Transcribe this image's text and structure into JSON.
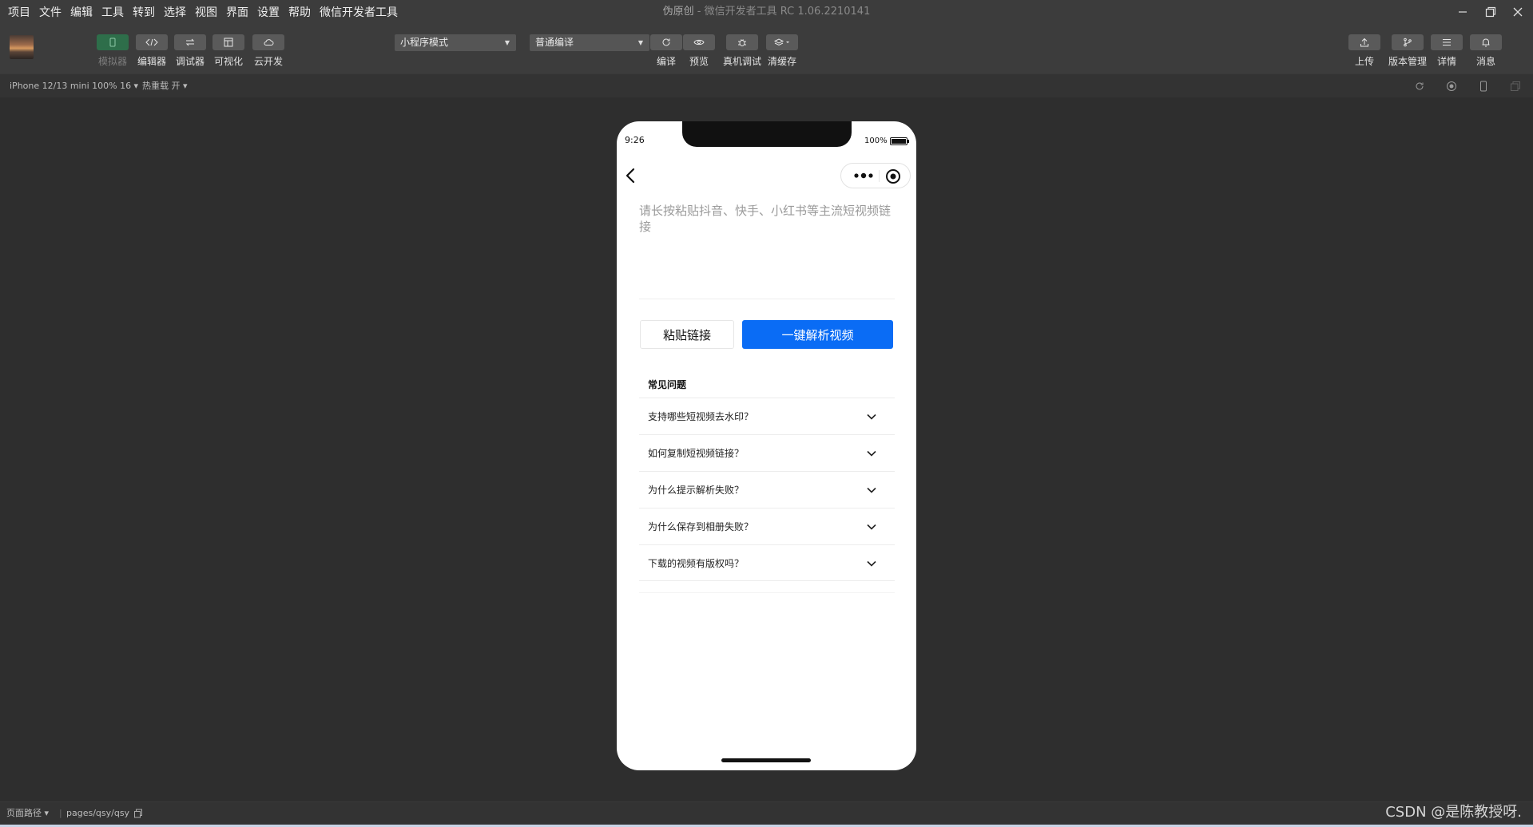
{
  "menubar": {
    "menus": [
      "项目",
      "文件",
      "编辑",
      "工具",
      "转到",
      "选择",
      "视图",
      "界面",
      "设置",
      "帮助",
      "微信开发者工具"
    ],
    "project_name": "伪原创",
    "separator": " - ",
    "app_title": "微信开发者工具 RC 1.06.2210141"
  },
  "toolbar": {
    "left_buttons": [
      {
        "label": "模拟器",
        "icon": "phone-icon",
        "active": true
      },
      {
        "label": "编辑器",
        "icon": "code-icon"
      },
      {
        "label": "调试器",
        "icon": "debug-icon"
      },
      {
        "label": "可视化",
        "icon": "layout-icon"
      },
      {
        "label": "云开发",
        "icon": "cloud-icon"
      }
    ],
    "mode_select": "小程序模式",
    "compile_select": "普通编译",
    "mid_buttons": [
      {
        "label": "编译",
        "icon": "refresh-icon"
      },
      {
        "label": "预览",
        "icon": "eye-icon"
      },
      {
        "label": "真机调试",
        "icon": "bug-icon"
      },
      {
        "label": "清缓存",
        "icon": "layers-icon"
      }
    ],
    "right_buttons": [
      {
        "label": "上传",
        "icon": "upload-icon"
      },
      {
        "label": "版本管理",
        "icon": "branch-icon"
      },
      {
        "label": "详情",
        "icon": "menu-icon"
      },
      {
        "label": "消息",
        "icon": "bell-icon"
      }
    ]
  },
  "subbar": {
    "device": "iPhone 12/13 mini 100% 16 ▾",
    "hot_reload": "热重载 开 ▾"
  },
  "phone": {
    "time": "9:26",
    "battery": "100%",
    "input_placeholder": "请长按粘贴抖音、快手、小红书等主流短视频链接",
    "input_value": "",
    "paste_button": "粘贴链接",
    "parse_button": "一键解析视频",
    "faq_title": "常见问题",
    "faq_items": [
      "支持哪些短视频去水印？",
      "如何复制短视频链接？",
      "为什么提示解析失败？",
      "为什么保存到相册失败？",
      "下载的视频有版权吗？"
    ]
  },
  "bottombar": {
    "path_label": "页面路径 ▾",
    "divider": "|",
    "path_value": "pages/qsy/qsy"
  },
  "watermark": "CSDN @是陈教授呀.",
  "colors": {
    "accent_blue": "#0a6cf5",
    "simulator_active": "#2e6e4a",
    "background": "#2e2e2e"
  }
}
